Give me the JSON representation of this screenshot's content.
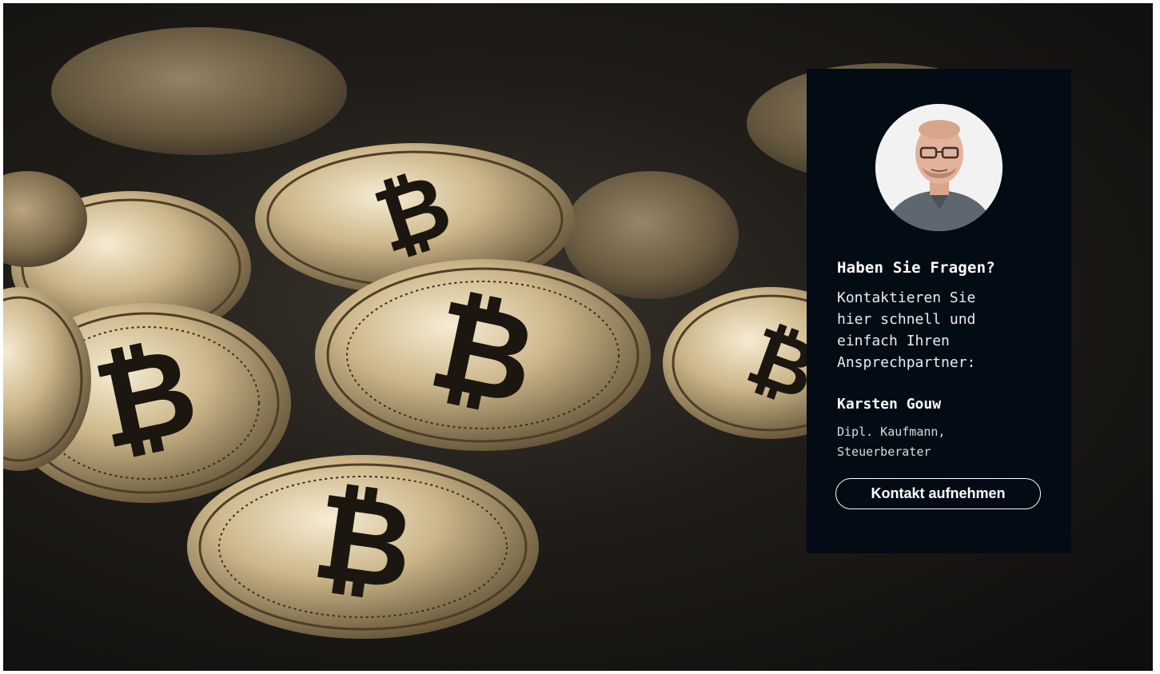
{
  "hero": {
    "image_subject": "bitcoin-coins-photo",
    "coin_symbol": "₿"
  },
  "contact_card": {
    "heading": "Haben Sie Fragen?",
    "intro_lines": [
      "Kontaktieren Sie",
      "hier schnell und",
      "einfach Ihren",
      "Ansprechpartner:"
    ],
    "name": "Karsten Gouw",
    "role_lines": [
      "Dipl. Kaufmann,",
      "Steuerberater"
    ],
    "button_label": "Kontakt aufnehmen"
  },
  "colors": {
    "card_background": "#030b14",
    "text": "#ffffff",
    "coin_gold": "#c9b48a"
  }
}
